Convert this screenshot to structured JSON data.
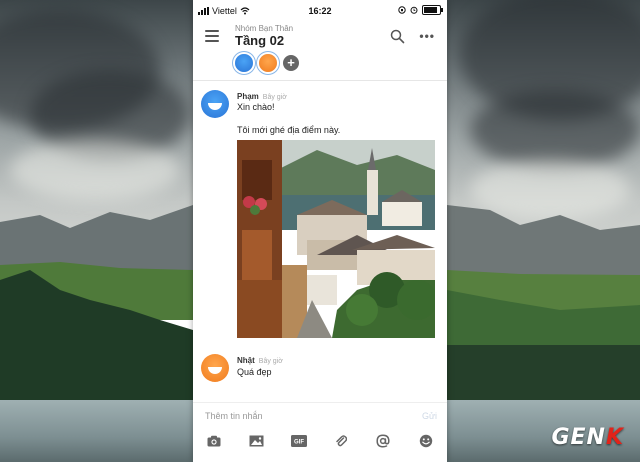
{
  "status_bar": {
    "carrier": "Viettel",
    "time": "16:22"
  },
  "header": {
    "subtitle": "Nhóm Bạn Thân",
    "title": "Tầng 02",
    "members": [
      {
        "color": "#2f86e4",
        "selected": true
      },
      {
        "color": "#f5871f",
        "selected": true
      }
    ],
    "add_label": "+",
    "icons": [
      "menu-icon",
      "search-icon",
      "more-icon"
    ]
  },
  "messages": [
    {
      "name": "Phạm",
      "time": "Bây giờ",
      "lines": [
        "Xin chào!",
        "Tôi mới ghé địa điểm này."
      ],
      "avatar_color": "#2f86e4",
      "has_photo": true
    },
    {
      "name": "Nhật",
      "time": "Bây giờ",
      "lines": [
        "Quá đẹp"
      ],
      "avatar_color": "#f5871f",
      "has_photo": false
    }
  ],
  "composer": {
    "placeholder": "Thêm tin nhắn",
    "send_label": "Gửi",
    "tools": [
      "camera-icon",
      "image-icon",
      "gif-icon",
      "attachment-icon",
      "mention-icon",
      "emoji-icon"
    ],
    "gif_label": "GIF"
  },
  "watermark": {
    "main": "GEN",
    "accent": "K"
  },
  "colors": {
    "accent": "#2f86e4",
    "orange": "#f5871f",
    "send_disabled": "#cfd9e6"
  }
}
